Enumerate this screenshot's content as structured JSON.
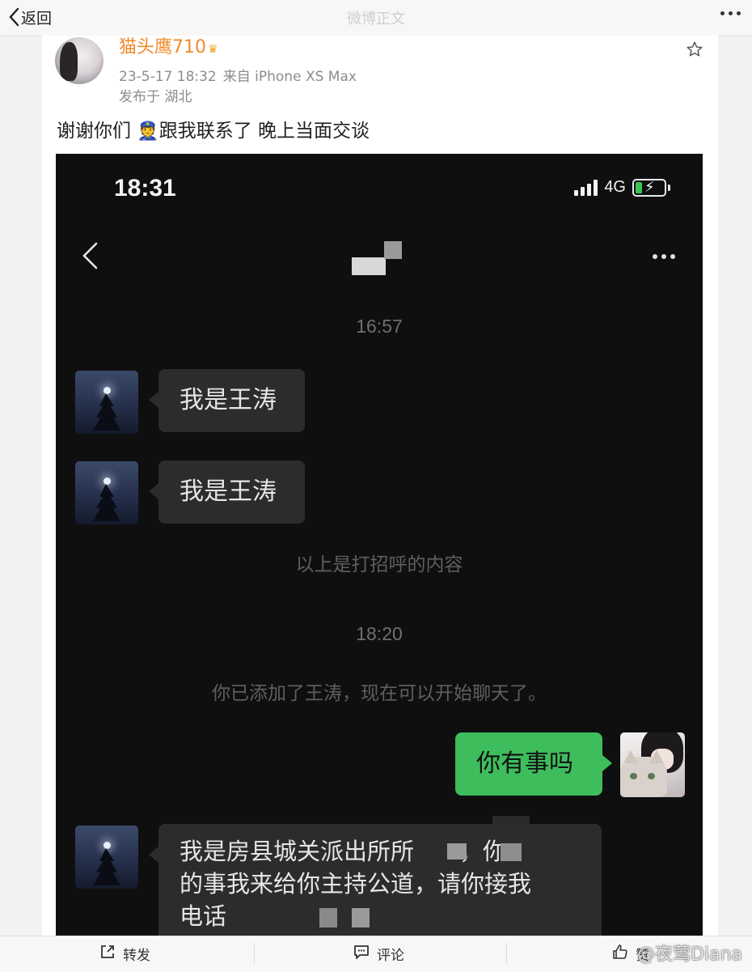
{
  "topbar": {
    "back_label": "返回",
    "title": "微博正文"
  },
  "post": {
    "username": "猫头鹰710",
    "time": "23-5-17 18:32",
    "source": "来自 iPhone XS Max",
    "location": "发布于 湖北",
    "text_before": "谢谢你们",
    "emoji": "👮",
    "text_after": "跟我联系了 晚上当面交谈"
  },
  "screenshot": {
    "status_time": "18:31",
    "network": "4G",
    "messages": [
      {
        "type": "time",
        "text": "16:57"
      },
      {
        "type": "in",
        "text": "我是王涛"
      },
      {
        "type": "in",
        "text": "我是王涛"
      },
      {
        "type": "note",
        "text": "以上是打招呼的内容"
      },
      {
        "type": "time",
        "text": "18:20"
      },
      {
        "type": "note",
        "text": "你已添加了王涛，现在可以开始聊天了。"
      },
      {
        "type": "out",
        "text": "你有事吗"
      },
      {
        "type": "in",
        "text_line1": "我是房县城关派出所所",
        "text_line1_end": "，你",
        "text_line2": "的事我来给你主持公道，请你接我",
        "text_line3": "电话"
      }
    ]
  },
  "bottombar": {
    "repost_label": "转发",
    "comment_label": "评论",
    "like_label": "赞",
    "watermark": "@夜莺Diana"
  },
  "colors": {
    "username": "#f08a2a",
    "bubble_out": "#3ebd5c",
    "bubble_in": "#2c2c2c",
    "chat_bg": "#0f0f0f"
  }
}
